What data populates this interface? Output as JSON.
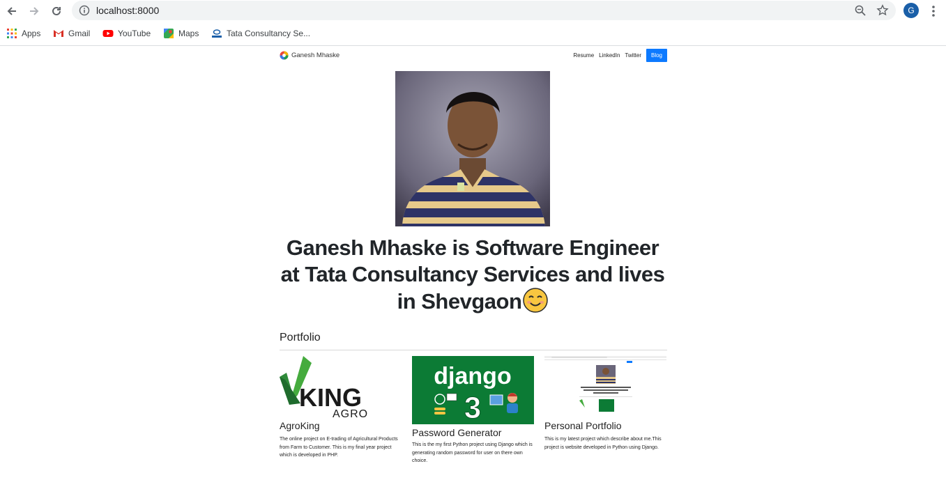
{
  "browser": {
    "url": "localhost:8000",
    "profile_initial": "G",
    "bookmarks": [
      {
        "label": "Apps",
        "icon": "apps-grid-icon"
      },
      {
        "label": "Gmail",
        "icon": "gmail-icon"
      },
      {
        "label": "YouTube",
        "icon": "youtube-icon"
      },
      {
        "label": "Maps",
        "icon": "maps-icon"
      },
      {
        "label": "Tata Consultancy Se...",
        "icon": "tata-icon"
      }
    ]
  },
  "site": {
    "brand": "Ganesh Mhaske",
    "nav": [
      {
        "label": "Resume"
      },
      {
        "label": "LinkedIn"
      },
      {
        "label": "Twitter"
      },
      {
        "label": "Blog",
        "active": true
      }
    ],
    "headline": "Ganesh Mhaske is Software Engineer at Tata Consultancy Services and lives in Shevgaon",
    "portfolio_title": "Portfolio",
    "projects": [
      {
        "title": "AgroKing",
        "logo_text": "KING",
        "logo_subtext": "AGRO",
        "description": "The online project on E-trading of Agricultural Products from Farm to Customer. This is my final year project which is developed in PHP."
      },
      {
        "title": "Password Generator",
        "logo_text": "django",
        "logo_subtext": "3",
        "description": "This is the my first Python project using Django which is generating random password for user on there own choice."
      },
      {
        "title": "Personal Portfolio",
        "description": "This is my latest project which describe about me.This project is website developed in Python using Django."
      }
    ]
  },
  "colors": {
    "blog_button": "#0d7aff",
    "django_bg": "#0c7b35",
    "agro_green": "#3c9b3c",
    "omnibox": "#f1f3f4",
    "profile": "#1a5fa8"
  }
}
